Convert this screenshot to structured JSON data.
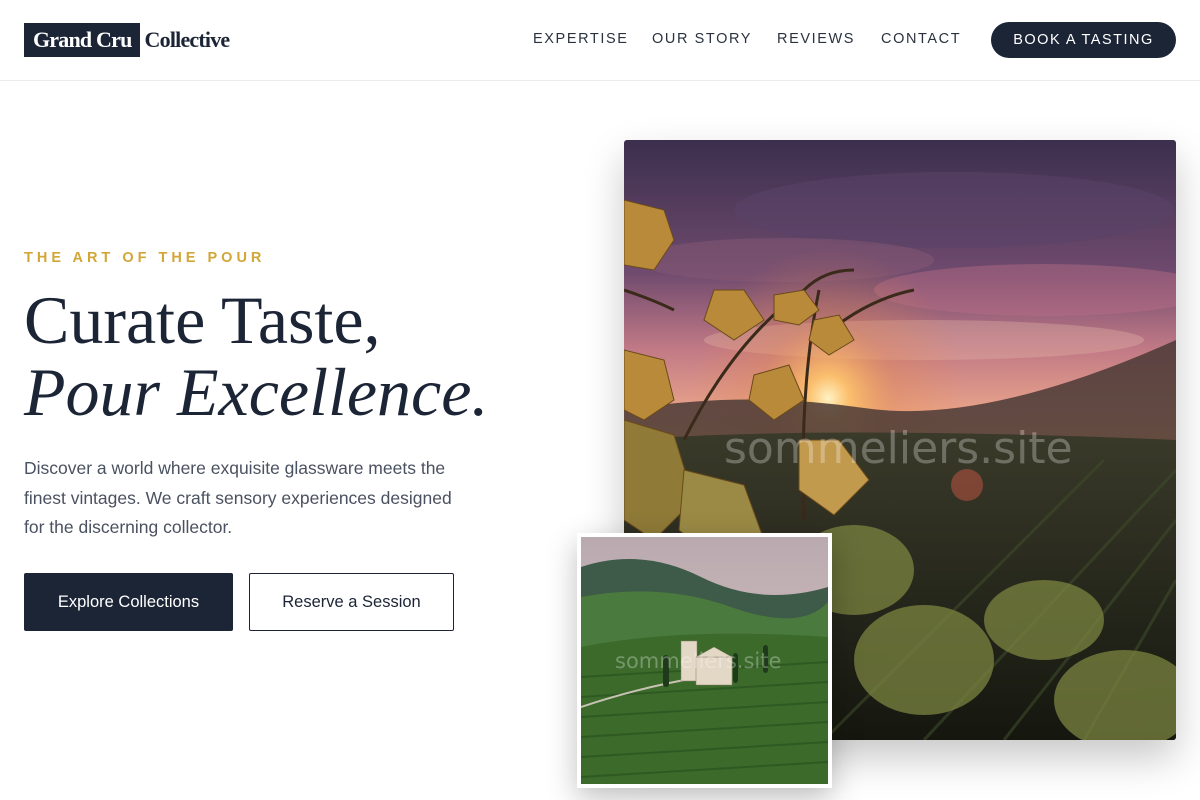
{
  "brand": {
    "logo_box": "Grand Cru",
    "logo_text": "Collective"
  },
  "nav": {
    "items": [
      {
        "label": "EXPERTISE"
      },
      {
        "label": "OUR STORY"
      },
      {
        "label": "REVIEWS"
      },
      {
        "label": "CONTACT"
      }
    ],
    "cta_label": "BOOK A TASTING"
  },
  "hero": {
    "eyebrow": "THE ART OF THE POUR",
    "title_line1": "Curate Taste,",
    "title_line2": "Pour Excellence.",
    "description": "Discover a world where exquisite glassware meets the finest vintages. We craft sensory experiences designed for the discerning collector.",
    "primary_button": "Explore Collections",
    "secondary_button": "Reserve a Session"
  },
  "images": {
    "main_watermark": "sommeliers.site",
    "inset_watermark": "sommeliers.site"
  },
  "colors": {
    "navy": "#1c2536",
    "gold_accent": "#d2a637",
    "body_text": "#4a5160"
  }
}
